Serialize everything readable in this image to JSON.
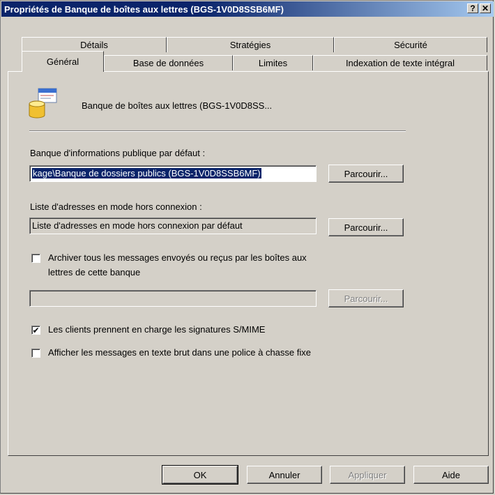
{
  "window": {
    "title": "Propriétés de Banque de boîtes aux lettres (BGS-1V0D8SSB6MF)",
    "help_glyph": "?",
    "close_glyph": "✕"
  },
  "tabs": {
    "row_back": [
      "Détails",
      "Stratégies",
      "Sécurité"
    ],
    "row_front": [
      "Général",
      "Base de données",
      "Limites",
      "Indexation de texte intégral"
    ]
  },
  "general": {
    "store_name": "Banque de boîtes aux lettres (BGS-1V0D8SS...",
    "icon": "mailbox-store-icon",
    "public_store_label": "Banque d'informations publique par défaut :",
    "public_store_value": "kage\\Banque de dossiers publics (BGS-1V0D8SSB6MF)",
    "browse_label": "Parcourir...",
    "offline_list_label": "Liste d'adresses en mode hors connexion :",
    "offline_list_value": "Liste d'adresses en mode hors connexion par défaut",
    "archive_label_line1": "Archiver tous les messages envoyés ou reçus par les boîtes aux",
    "archive_label_line2": "lettres de cette banque",
    "archive_checked": false,
    "archive_value": "",
    "smime_label": "Les clients prennent en charge les signatures S/MIME",
    "smime_checked": true,
    "plain_text_label": "Afficher les messages en texte brut dans une police à chasse fixe",
    "plain_text_checked": false,
    "check_glyph": "✔"
  },
  "footer": {
    "ok": "OK",
    "cancel": "Annuler",
    "apply": "Appliquer",
    "help": "Aide"
  }
}
